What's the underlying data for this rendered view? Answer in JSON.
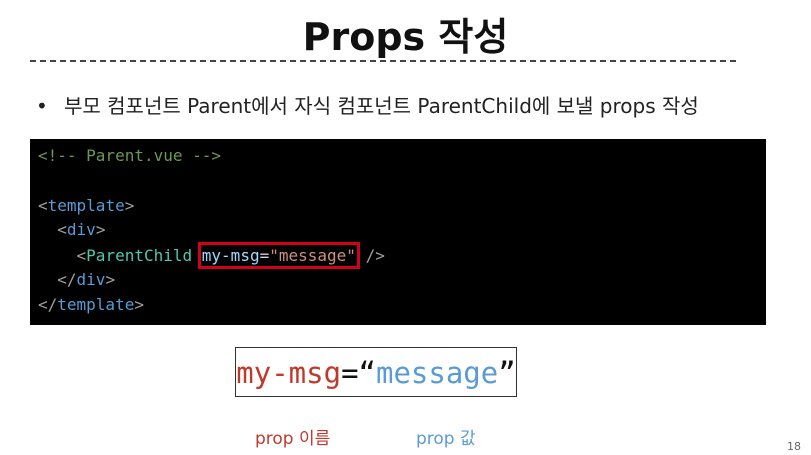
{
  "title": "Props 작성",
  "bullet": {
    "symbol": "•",
    "text": "부모 컴포넌트 Parent에서 자식 컴포넌트 ParentChild에 보낼 props 작성"
  },
  "code": {
    "comment": "<!-- Parent.vue -->",
    "template_open": "template",
    "div_open": "div",
    "component": "ParentChild",
    "attr_name": "my-msg",
    "equals": "=",
    "attr_value": "\"message\"",
    "self_close": "/>",
    "div_close": "div",
    "template_close": "template"
  },
  "example": {
    "prop_name": "my-msg",
    "equals": "=",
    "open_quote": "“",
    "prop_value": "message",
    "close_quote": "”"
  },
  "labels": {
    "name": "prop 이름",
    "value": "prop 값"
  },
  "page_number": "18",
  "colors": {
    "highlight": "#d0021b",
    "prop_name": "#c0392b",
    "prop_value": "#5b9bd5",
    "code_background": "#000000"
  }
}
